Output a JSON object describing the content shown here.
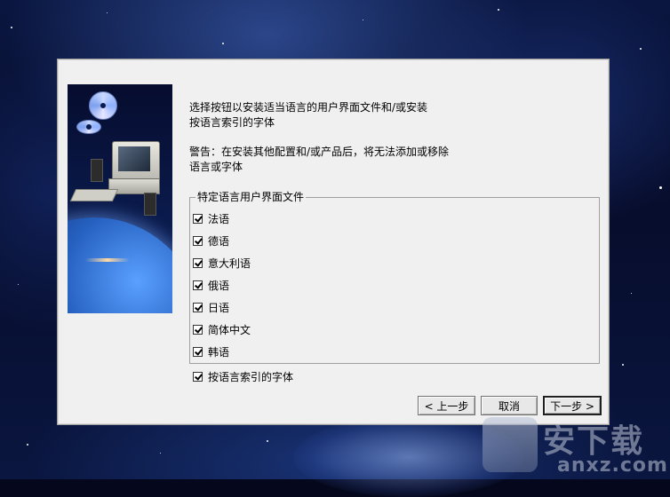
{
  "dialog": {
    "intro_line1": "选择按钮以安装适当语言的用户界面文件和/或安装",
    "intro_line2": "按语言索引的字体",
    "warning_line1": "警告：在安装其他配置和/或产品后，将无法添加或移除",
    "warning_line2": "语言或字体"
  },
  "language_group": {
    "title": "特定语言用户界面文件",
    "items": [
      {
        "label": "法语",
        "checked": true
      },
      {
        "label": "德语",
        "checked": true
      },
      {
        "label": "意大利语",
        "checked": true
      },
      {
        "label": "俄语",
        "checked": true
      },
      {
        "label": "日语",
        "checked": true
      },
      {
        "label": "简体中文",
        "checked": true
      },
      {
        "label": "韩语",
        "checked": true
      }
    ]
  },
  "fonts_option": {
    "label": "按语言索引的字体",
    "checked": true
  },
  "buttons": {
    "back": "< 上一步",
    "cancel": "取消",
    "next": "下一步 >"
  },
  "watermark": {
    "text": "安下载",
    "sub": "anxz.com"
  }
}
